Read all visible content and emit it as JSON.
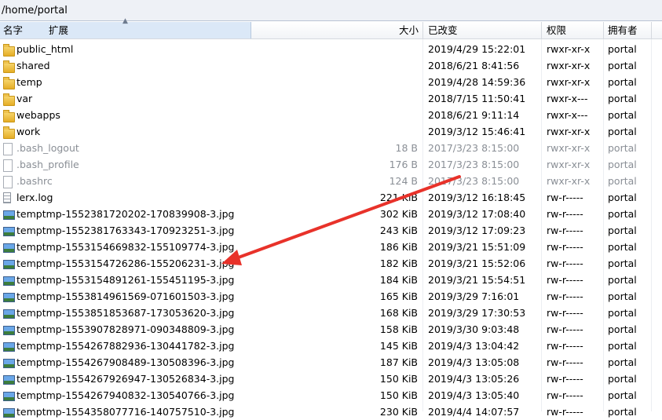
{
  "path": "/home/portal",
  "columns": {
    "name": "名字",
    "ext": "扩展",
    "size": "大小",
    "modified": "已改变",
    "perms": "权限",
    "owner": "拥有者"
  },
  "files": [
    {
      "name": "public_html",
      "size": "",
      "modified": "2019/4/29 15:22:01",
      "perms": "rwxr-xr-x",
      "owner": "portal",
      "icon": "folder-icon",
      "hidden": false
    },
    {
      "name": "shared",
      "size": "",
      "modified": "2018/6/21 8:41:56",
      "perms": "rwxr-xr-x",
      "owner": "portal",
      "icon": "folder-icon",
      "hidden": false
    },
    {
      "name": "temp",
      "size": "",
      "modified": "2019/4/28 14:59:36",
      "perms": "rwxr-xr-x",
      "owner": "portal",
      "icon": "folder-icon",
      "hidden": false
    },
    {
      "name": "var",
      "size": "",
      "modified": "2018/7/15 11:50:41",
      "perms": "rwxr-x---",
      "owner": "portal",
      "icon": "folder-icon",
      "hidden": false
    },
    {
      "name": "webapps",
      "size": "",
      "modified": "2018/6/21 9:11:14",
      "perms": "rwxr-x---",
      "owner": "portal",
      "icon": "folder-icon",
      "hidden": false
    },
    {
      "name": "work",
      "size": "",
      "modified": "2019/3/12 15:46:41",
      "perms": "rwxr-xr-x",
      "owner": "portal",
      "icon": "folder-icon",
      "hidden": false
    },
    {
      "name": ".bash_logout",
      "size": "18 B",
      "modified": "2017/3/23 8:15:00",
      "perms": "rwxr-xr-x",
      "owner": "portal",
      "icon": "file-icon",
      "hidden": true
    },
    {
      "name": ".bash_profile",
      "size": "176 B",
      "modified": "2017/3/23 8:15:00",
      "perms": "rwxr-xr-x",
      "owner": "portal",
      "icon": "file-icon",
      "hidden": true
    },
    {
      "name": ".bashrc",
      "size": "124 B",
      "modified": "2017/3/23 8:15:00",
      "perms": "rwxr-xr-x",
      "owner": "portal",
      "icon": "file-icon",
      "hidden": true
    },
    {
      "name": "lerx.log",
      "size": "221 KiB",
      "modified": "2019/3/12 16:18:45",
      "perms": "rw-r-----",
      "owner": "portal",
      "icon": "text-file-icon",
      "hidden": false
    },
    {
      "name": "temptmp-1552381720202-170839908-3.jpg",
      "size": "302 KiB",
      "modified": "2019/3/12 17:08:40",
      "perms": "rw-r-----",
      "owner": "portal",
      "icon": "image-file-icon",
      "hidden": false
    },
    {
      "name": "temptmp-1552381763343-170923251-3.jpg",
      "size": "243 KiB",
      "modified": "2019/3/12 17:09:23",
      "perms": "rw-r-----",
      "owner": "portal",
      "icon": "image-file-icon",
      "hidden": false
    },
    {
      "name": "temptmp-1553154669832-155109774-3.jpg",
      "size": "186 KiB",
      "modified": "2019/3/21 15:51:09",
      "perms": "rw-r-----",
      "owner": "portal",
      "icon": "image-file-icon",
      "hidden": false
    },
    {
      "name": "temptmp-1553154726286-155206231-3.jpg",
      "size": "182 KiB",
      "modified": "2019/3/21 15:52:06",
      "perms": "rw-r-----",
      "owner": "portal",
      "icon": "image-file-icon",
      "hidden": false
    },
    {
      "name": "temptmp-1553154891261-155451195-3.jpg",
      "size": "184 KiB",
      "modified": "2019/3/21 15:54:51",
      "perms": "rw-r-----",
      "owner": "portal",
      "icon": "image-file-icon",
      "hidden": false
    },
    {
      "name": "temptmp-1553814961569-071601503-3.jpg",
      "size": "165 KiB",
      "modified": "2019/3/29 7:16:01",
      "perms": "rw-r-----",
      "owner": "portal",
      "icon": "image-file-icon",
      "hidden": false
    },
    {
      "name": "temptmp-1553851853687-173053620-3.jpg",
      "size": "168 KiB",
      "modified": "2019/3/29 17:30:53",
      "perms": "rw-r-----",
      "owner": "portal",
      "icon": "image-file-icon",
      "hidden": false
    },
    {
      "name": "temptmp-1553907828971-090348809-3.jpg",
      "size": "158 KiB",
      "modified": "2019/3/30 9:03:48",
      "perms": "rw-r-----",
      "owner": "portal",
      "icon": "image-file-icon",
      "hidden": false
    },
    {
      "name": "temptmp-1554267882936-130441782-3.jpg",
      "size": "145 KiB",
      "modified": "2019/4/3 13:04:42",
      "perms": "rw-r-----",
      "owner": "portal",
      "icon": "image-file-icon",
      "hidden": false
    },
    {
      "name": "temptmp-1554267908489-130508396-3.jpg",
      "size": "187 KiB",
      "modified": "2019/4/3 13:05:08",
      "perms": "rw-r-----",
      "owner": "portal",
      "icon": "image-file-icon",
      "hidden": false
    },
    {
      "name": "temptmp-1554267926947-130526834-3.jpg",
      "size": "150 KiB",
      "modified": "2019/4/3 13:05:26",
      "perms": "rw-r-----",
      "owner": "portal",
      "icon": "image-file-icon",
      "hidden": false
    },
    {
      "name": "temptmp-1554267940832-130540766-3.jpg",
      "size": "150 KiB",
      "modified": "2019/4/3 13:05:40",
      "perms": "rw-r-----",
      "owner": "portal",
      "icon": "image-file-icon",
      "hidden": false
    },
    {
      "name": "temptmp-1554358077716-140757510-3.jpg",
      "size": "230 KiB",
      "modified": "2019/4/4 14:07:57",
      "perms": "rw-r-----",
      "owner": "portal",
      "icon": "image-file-icon",
      "hidden": false
    }
  ],
  "annotation": {
    "color": "#e8322a",
    "icon": "arrow-annotation"
  }
}
